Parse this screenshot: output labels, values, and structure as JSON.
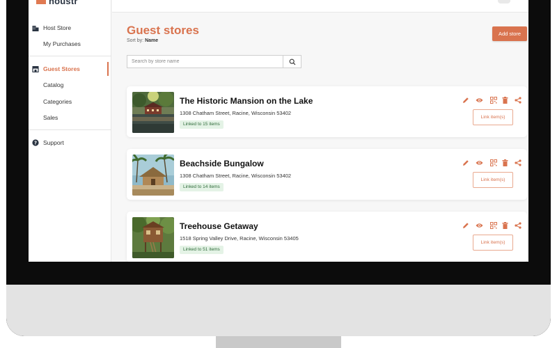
{
  "app": {
    "logo_text": "houstr"
  },
  "sidebar": {
    "items": [
      {
        "label": "Host Store",
        "icon": "building-icon",
        "active": false
      },
      {
        "label": "My Purchases",
        "icon": "",
        "active": false
      },
      {
        "label": "Guest Stores",
        "icon": "storefront-icon",
        "active": true
      },
      {
        "label": "Catalog",
        "icon": "",
        "active": false
      },
      {
        "label": "Categories",
        "icon": "",
        "active": false
      },
      {
        "label": "Sales",
        "icon": "",
        "active": false
      },
      {
        "label": "Support",
        "icon": "help-circle-icon",
        "active": false
      }
    ]
  },
  "main": {
    "title": "Guest stores",
    "sort_prefix": "Sort by:",
    "sort_value": "Name",
    "add_button": "Add store",
    "search_placeholder": "Search by store name"
  },
  "stores": [
    {
      "name": "The Historic Mansion on the Lake",
      "address": "1308 Chatham Street, Racine, Wisconsin 53402",
      "linked": "Linked to 15 items",
      "link_button": "Link item(s)",
      "image": "lake-mansion-photo"
    },
    {
      "name": "Beachside Bungalow",
      "address": "1308 Chatham Street, Racine, Wisconsin 53402",
      "linked": "Linked to 14 items",
      "link_button": "Link item(s)",
      "image": "beach-bungalow-photo"
    },
    {
      "name": "Treehouse Getaway",
      "address": "1518 Spring Valley Drive, Racine, Wisconsin 53405",
      "linked": "Linked to 51 items",
      "link_button": "Link item(s)",
      "image": "treehouse-photo"
    }
  ],
  "card_actions": [
    "edit-icon",
    "view-icon",
    "qr-code-icon",
    "delete-icon",
    "share-icon"
  ],
  "colors": {
    "accent": "#d9734e",
    "badge_bg": "#e4f3e6",
    "badge_text": "#2f6b3a",
    "sidebar_text": "#333333"
  }
}
